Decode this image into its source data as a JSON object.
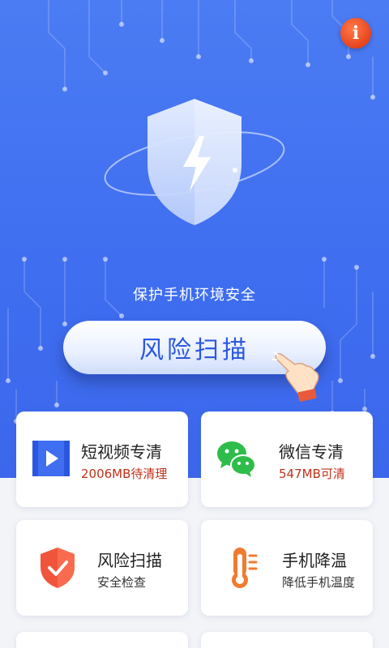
{
  "hero": {
    "tagline": "保护手机环境安全",
    "scan_button_label": "风险扫描",
    "info_label": "i",
    "info_icon": "info-icon",
    "shield_icon": "shield-bolt-icon",
    "hand_icon": "pointing-hand-icon"
  },
  "cards": [
    {
      "title": "短视频专清",
      "subtitle": "2006MB待清理",
      "icon": "video-clean-icon"
    },
    {
      "title": "微信专清",
      "subtitle": "547MB可清",
      "icon": "wechat-icon"
    },
    {
      "title": "风险扫描",
      "subtitle": "安全检查",
      "icon": "shield-check-icon"
    },
    {
      "title": "手机降温",
      "subtitle": "降低手机温度",
      "icon": "thermometer-icon"
    }
  ],
  "colors": {
    "hero_bg": "#4b7cf3",
    "accent_text": "#2b57e0",
    "highlight_red": "#c0311a",
    "info_orange": "#e8431c",
    "wechat_green": "#2ebd4a"
  }
}
